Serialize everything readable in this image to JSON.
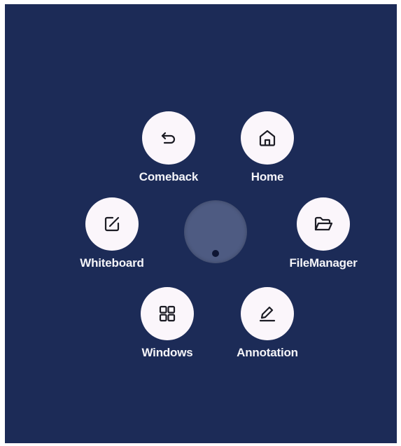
{
  "menu": {
    "items": [
      {
        "label": "Comeback",
        "icon": "undo-arrow-icon"
      },
      {
        "label": "Home",
        "icon": "home-icon"
      },
      {
        "label": "Whiteboard",
        "icon": "edit-square-icon"
      },
      {
        "label": "FileManager",
        "icon": "folder-open-icon"
      },
      {
        "label": "Windows",
        "icon": "grid-icon"
      },
      {
        "label": "Annotation",
        "icon": "pen-underline-icon"
      }
    ]
  },
  "colors": {
    "background": "#1c2b57",
    "button": "#fbf6fb",
    "knob": "#4e5b82",
    "text": "#f4f4f8"
  }
}
